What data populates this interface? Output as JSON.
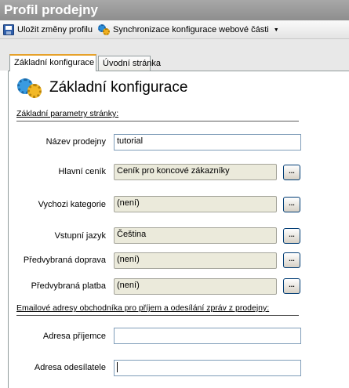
{
  "window": {
    "title": "Profil prodejny"
  },
  "toolbar": {
    "save_label": "Uložit změny profilu",
    "sync_label": "Synchronizace konfigurace webové části",
    "sync_caret": "▼"
  },
  "tabs": [
    {
      "label": "Základní konfigurace",
      "active": true
    },
    {
      "label": "Úvodní stránka",
      "active": false
    }
  ],
  "main": {
    "title": "Základní konfigurace",
    "section1": "Základní parametry stránky:",
    "section2": "Emailové adresy obchodníka pro příjem a odesílání zpráv z prodejny:",
    "browse_label": "...",
    "fields": {
      "shop_name": {
        "label": "Název prodejny",
        "value": "tutorial"
      },
      "price_list": {
        "label": "Hlavní ceník",
        "value": "Ceník pro koncové zákazníky"
      },
      "default_category": {
        "label": "Vychozi kategorie",
        "value": "(není)"
      },
      "input_language": {
        "label": "Vstupní jazyk",
        "value": "Čeština"
      },
      "preselected_shipping": {
        "label": "Předvybraná doprava",
        "value": "(není)"
      },
      "preselected_payment": {
        "label": "Předvybraná platba",
        "value": "(není)"
      },
      "recipient_address": {
        "label": "Adresa příjemce",
        "value": ""
      },
      "sender_address": {
        "label": "Adresa odesílatele",
        "value": ""
      }
    }
  },
  "colors": {
    "title_bar": "#999999",
    "active_tab_accent": "#e6a12a",
    "readonly_field": "#ebeadb"
  },
  "icons": {
    "save": "floppy-disk-icon",
    "sync": "gears-icon",
    "header": "gears-icon"
  }
}
